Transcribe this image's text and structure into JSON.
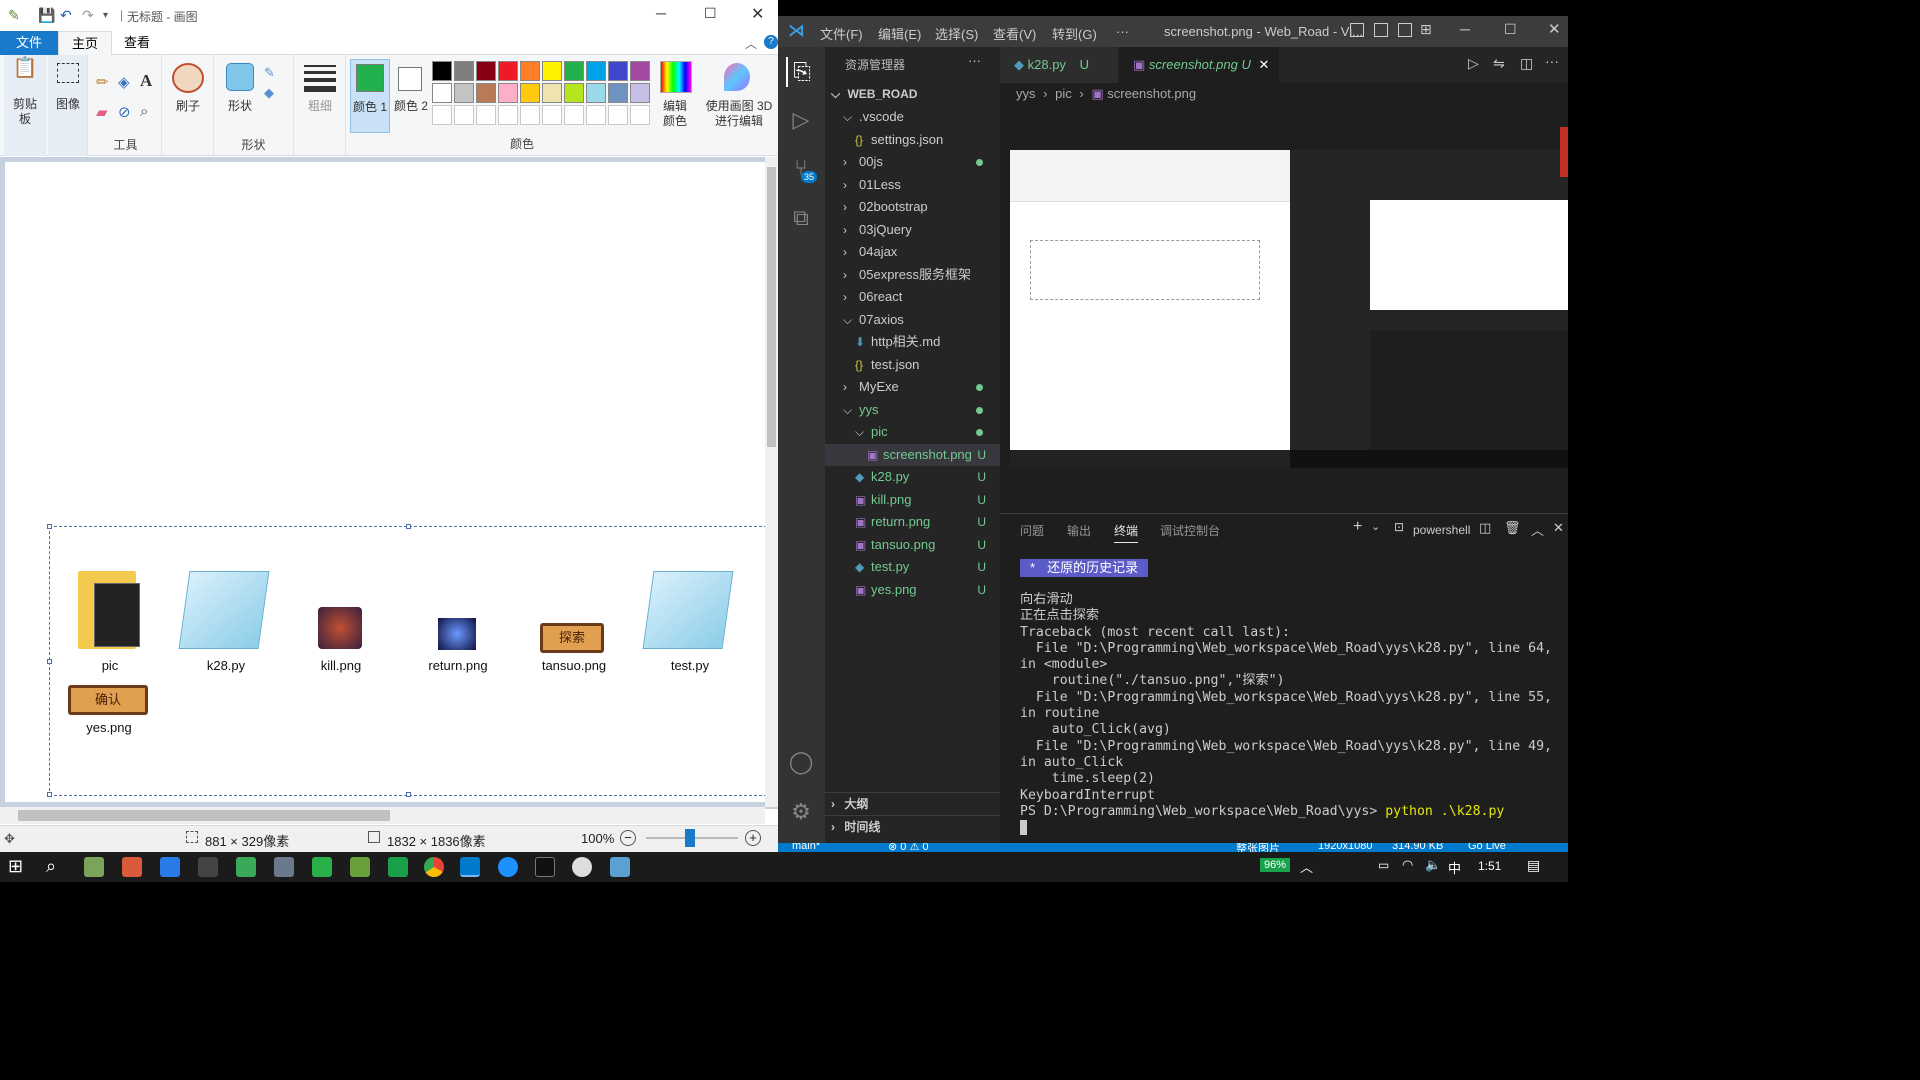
{
  "paint": {
    "title": "无标题 - 画图",
    "tabs": [
      "文件",
      "主页",
      "查看"
    ],
    "groups": {
      "clipboard": "剪贴板",
      "image": "图像",
      "tools": "工具",
      "brushes": "刷子",
      "shapes": "形状",
      "size": "粗细",
      "color1": "颜色 1",
      "color2": "颜色 2",
      "colors": "颜色",
      "edit_colors": "编辑颜色",
      "paint3d": "使用画图 3D 进行编辑"
    },
    "palette": [
      "#000000",
      "#7f7f7f",
      "#880015",
      "#ed1c24",
      "#ff7f27",
      "#fff200",
      "#22b14c",
      "#00a2e8",
      "#3f48cc",
      "#a349a4",
      "#ffffff",
      "#c3c3c3",
      "#b97a57",
      "#ffaec9",
      "#ffc90e",
      "#efe4b0",
      "#b5e61d",
      "#99d9ea",
      "#7092be",
      "#c8bfe7"
    ],
    "color1_value": "#22b14c",
    "files": [
      {
        "name": "pic",
        "icon": "folder-icon"
      },
      {
        "name": "k28.py",
        "icon": "notepad-icon"
      },
      {
        "name": "kill.png",
        "icon": "kill-image-icon"
      },
      {
        "name": "return.png",
        "icon": "return-image-icon"
      },
      {
        "name": "tansuo.png",
        "icon": "tansuo-image-icon"
      },
      {
        "name": "test.py",
        "icon": "notepad-icon"
      },
      {
        "name": "yes.png",
        "icon": "yes-image-icon"
      }
    ],
    "tansuo_text": "探索",
    "yes_text": "确认",
    "status": {
      "selection": "881 × 329像素",
      "size": "1832 × 1836像素",
      "zoom": "100%"
    }
  },
  "vscode": {
    "menus": [
      "文件(F)",
      "编辑(E)",
      "选择(S)",
      "查看(V)",
      "转到(G)",
      "···"
    ],
    "window_title": "screenshot.png - Web_Road - Vi...",
    "explorer_title": "资源管理器",
    "root": "WEB_ROAD",
    "tree": [
      {
        "label": ".vscode",
        "indent": 1,
        "type": "folder-open"
      },
      {
        "label": "settings.json",
        "indent": 2,
        "type": "json"
      },
      {
        "label": "00js",
        "indent": 1,
        "type": "folder",
        "dot": true
      },
      {
        "label": "01Less",
        "indent": 1,
        "type": "folder"
      },
      {
        "label": "02bootstrap",
        "indent": 1,
        "type": "folder"
      },
      {
        "label": "03jQuery",
        "indent": 1,
        "type": "folder"
      },
      {
        "label": "04ajax",
        "indent": 1,
        "type": "folder"
      },
      {
        "label": "05express服务框架",
        "indent": 1,
        "type": "folder"
      },
      {
        "label": "06react",
        "indent": 1,
        "type": "folder"
      },
      {
        "label": "07axios",
        "indent": 1,
        "type": "folder-open"
      },
      {
        "label": "http相关.md",
        "indent": 2,
        "type": "md"
      },
      {
        "label": "test.json",
        "indent": 2,
        "type": "json"
      },
      {
        "label": "MyExe",
        "indent": 1,
        "type": "folder",
        "dot": true
      },
      {
        "label": "yys",
        "indent": 1,
        "type": "folder-open",
        "dot": true,
        "green": true
      },
      {
        "label": "pic",
        "indent": 2,
        "type": "folder-open",
        "dot": true,
        "green": true
      },
      {
        "label": "screenshot.png",
        "indent": 3,
        "type": "png",
        "u": "U",
        "green": true,
        "selected": true
      },
      {
        "label": "k28.py",
        "indent": 2,
        "type": "py",
        "u": "U",
        "green": true
      },
      {
        "label": "kill.png",
        "indent": 2,
        "type": "png",
        "u": "U",
        "green": true
      },
      {
        "label": "return.png",
        "indent": 2,
        "type": "png",
        "u": "U",
        "green": true
      },
      {
        "label": "tansuo.png",
        "indent": 2,
        "type": "png",
        "u": "U",
        "green": true
      },
      {
        "label": "test.py",
        "indent": 2,
        "type": "py",
        "u": "U",
        "green": true
      },
      {
        "label": "yes.png",
        "indent": 2,
        "type": "png",
        "u": "U",
        "green": true
      }
    ],
    "outline": "大纲",
    "timeline": "时间线",
    "tabs": [
      {
        "label": "k28.py",
        "u": "U"
      },
      {
        "label": "screenshot.png",
        "u": "U"
      }
    ],
    "breadcrumb": [
      "yys",
      "pic",
      "screenshot.png"
    ],
    "badge": "35",
    "panel_tabs": [
      "问题",
      "输出",
      "终端",
      "调试控制台"
    ],
    "shell": "powershell",
    "history_label": "还原的历史记录",
    "terminal_lines": [
      "向右滑动",
      "正在点击探索",
      "Traceback (most recent call last):",
      "  File \"D:\\Programming\\Web_workspace\\Web_Road\\yys\\k28.py\", line 64,",
      "in <module>",
      "    routine(\"./tansuo.png\",\"探索\")",
      "  File \"D:\\Programming\\Web_workspace\\Web_Road\\yys\\k28.py\", line 55,",
      "in routine",
      "    auto_Click(avg)",
      "  File \"D:\\Programming\\Web_workspace\\Web_Road\\yys\\k28.py\", line 49,",
      "in auto_Click",
      "    time.sleep(2)",
      "KeyboardInterrupt"
    ],
    "prompt": "PS D:\\Programming\\Web_workspace\\Web_Road\\yys> ",
    "command": "python .\\k28.py",
    "status": {
      "branch": "main*",
      "errors": "⊗ 0 ⚠ 0",
      "image_label": "整张图片",
      "dims": "1920x1080",
      "filesize": "314.90 KB",
      "golive": "Go Live"
    }
  },
  "taskbar": {
    "battery": "96%",
    "ime": "中",
    "time": "1:51"
  }
}
